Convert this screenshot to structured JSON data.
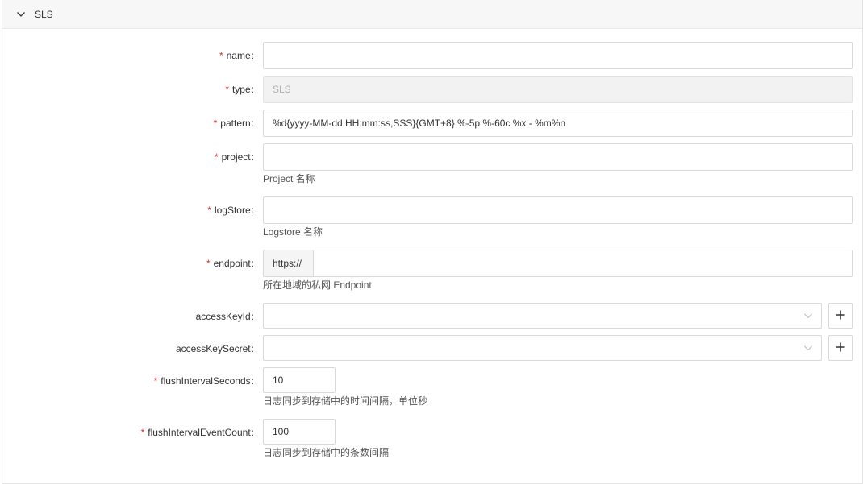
{
  "section": {
    "title": "SLS",
    "collapse_icon": "chevron-down-icon"
  },
  "form": {
    "name": {
      "label": "name",
      "value": ""
    },
    "type": {
      "label": "type",
      "value": "SLS"
    },
    "pattern": {
      "label": "pattern",
      "value": "%d{yyyy-MM-dd HH:mm:ss,SSS}{GMT+8} %-5p %-60c %x - %m%n"
    },
    "project": {
      "label": "project",
      "value": "",
      "help": "Project 名称"
    },
    "logStore": {
      "label": "logStore",
      "value": "",
      "help": "Logstore 名称"
    },
    "endpoint": {
      "label": "endpoint",
      "prefix": "https://",
      "value": "",
      "help": "所在地域的私网 Endpoint"
    },
    "accessKeyId": {
      "label": "accessKeyId",
      "value": "",
      "add_icon": "plus-icon"
    },
    "accessKeySecret": {
      "label": "accessKeySecret",
      "value": "",
      "add_icon": "plus-icon"
    },
    "flushIntervalSeconds": {
      "label": "flushIntervalSeconds",
      "value": "10",
      "help": "日志同步到存储中的时间间隔，单位秒"
    },
    "flushIntervalEventCount": {
      "label": "flushIntervalEventCount",
      "value": "100",
      "help": "日志同步到存储中的条数间隔"
    }
  },
  "required_mark": "*",
  "colon": ":",
  "colors": {
    "required": "#d93026",
    "border": "#d9d9d9",
    "disabled_bg": "#f2f2f2"
  }
}
